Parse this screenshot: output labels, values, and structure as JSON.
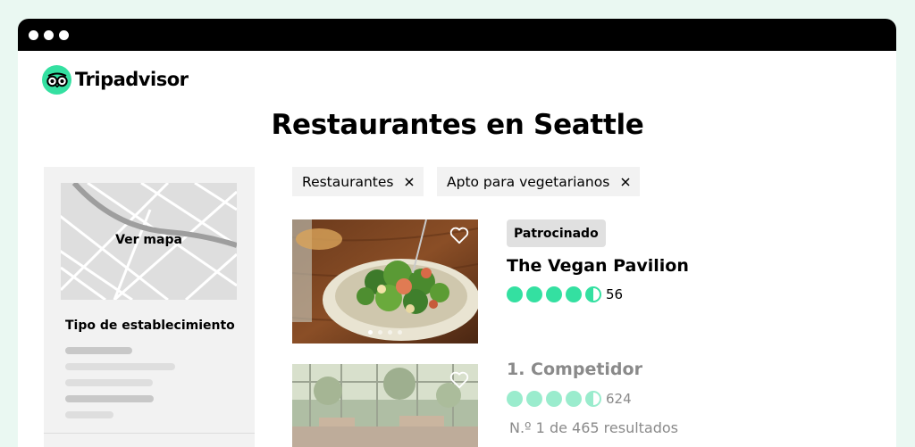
{
  "browser": {
    "window_controls": [
      "dot",
      "dot",
      "dot"
    ]
  },
  "brand": {
    "name": "Tripadvisor",
    "color": "#34e0a1",
    "icon": "owl-logo-icon"
  },
  "page": {
    "title": "Restaurantes en Seattle"
  },
  "sidebar": {
    "map_label": "Ver mapa",
    "filter_section_title": "Tipo de establecimiento"
  },
  "filters": [
    {
      "label": "Restaurantes",
      "icon": "close-icon"
    },
    {
      "label": "Apto para vegetarianos",
      "icon": "close-icon"
    }
  ],
  "listings": [
    {
      "badge": "Patrocinado",
      "name": "The Vegan Pavilion",
      "rating": 4.5,
      "rating_max": 5,
      "review_count": "56",
      "rating_color": "#34e0a1",
      "image": "salad-photo",
      "favorite_icon": "heart-icon",
      "gallery_total": 4,
      "gallery_current": 1
    },
    {
      "name": "1. Competidor",
      "rating": 4.5,
      "rating_max": 5,
      "review_count": "624",
      "rating_color": "#9aeccd",
      "position_text": "N.º 1 de 465 resultados",
      "image": "restaurant-interior-photo",
      "favorite_icon": "heart-icon"
    }
  ]
}
